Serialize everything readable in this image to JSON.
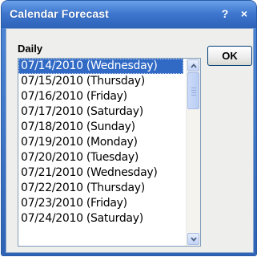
{
  "window": {
    "title": "Calendar Forecast",
    "help_label": "?",
    "close_label": "×"
  },
  "group_label": "Daily",
  "ok_label": "OK",
  "list": {
    "selected_index": 0,
    "items": [
      "07/14/2010 (Wednesday)",
      "07/15/2010 (Thursday)",
      "07/16/2010 (Friday)",
      "07/17/2010 (Saturday)",
      "07/18/2010 (Sunday)",
      "07/19/2010 (Monday)",
      "07/20/2010 (Tuesday)",
      "07/21/2010 (Wednesday)",
      "07/22/2010 (Thursday)",
      "07/23/2010 (Friday)",
      "07/24/2010 (Saturday)"
    ]
  },
  "scrollbar": {
    "up_icon": "chevron-up-icon",
    "down_icon": "chevron-down-icon"
  },
  "colors": {
    "titlebar": "#3f78cf",
    "selection": "#316ac5"
  }
}
